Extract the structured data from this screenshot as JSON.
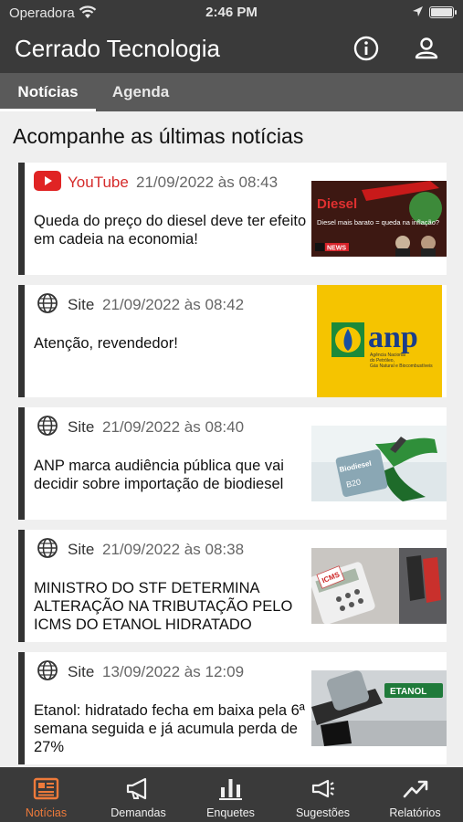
{
  "status_bar": {
    "carrier": "Operadora",
    "time": "2:46 PM"
  },
  "app_bar": {
    "title": "Cerrado Tecnologia"
  },
  "tabs": [
    {
      "label": "Notícias",
      "active": true
    },
    {
      "label": "Agenda",
      "active": false
    }
  ],
  "news": {
    "section_title": "Acompanhe as últimas notícias",
    "items": [
      {
        "source": "YouTube",
        "source_icon": "youtube-icon",
        "date": "21/09/2022 às 08:43",
        "headline": "Queda do preço do diesel deve ter efeito em cadeia na economia!",
        "thumb_text": {
          "title": "Diesel",
          "subtitle": "Diesel mais barato = queda na inflação?",
          "badge": "NEWS"
        }
      },
      {
        "source": "Site",
        "source_icon": "globe-icon",
        "date": "21/09/2022 às 08:42",
        "headline": "Atenção, revendedor!",
        "thumb_text": {
          "logo": "anp",
          "tagline_1": "Agência Nacional",
          "tagline_2": "do Petróleo,",
          "tagline_3": "Gás Natural e Biocombustíveis"
        }
      },
      {
        "source": "Site",
        "source_icon": "globe-icon",
        "date": "21/09/2022 às 08:40",
        "headline": "ANP marca audiência pública que vai decidir sobre importação de biodiesel",
        "thumb_text": {
          "label_1": "Biodiesel",
          "label_2": "B20"
        }
      },
      {
        "source": "Site",
        "source_icon": "globe-icon",
        "date": "21/09/2022 às 08:38",
        "headline": "MINISTRO DO STF DETERMINA ALTERAÇÃO NA TRIBUTAÇÃO PELO ICMS DO ETANOL HIDRATADO",
        "thumb_text": {
          "label": "ICMS"
        }
      },
      {
        "source": "Site",
        "source_icon": "globe-icon",
        "date": "13/09/2022 às 12:09",
        "headline": "Etanol: hidratado fecha em baixa pela 6ª semana seguida e já acumula perda de 27%",
        "thumb_text": {
          "label": "ETANOL"
        }
      }
    ]
  },
  "bottom_nav": [
    {
      "label": "Notícias",
      "icon": "newspaper-icon",
      "active": true
    },
    {
      "label": "Demandas",
      "icon": "megaphone-icon",
      "active": false
    },
    {
      "label": "Enquetes",
      "icon": "bar-chart-icon",
      "active": false
    },
    {
      "label": "Sugestões",
      "icon": "bullhorn-icon",
      "active": false
    },
    {
      "label": "Relatórios",
      "icon": "trending-up-icon",
      "active": false
    }
  ],
  "colors": {
    "bar": "#3a3a3a",
    "tabs": "#5a5a5a",
    "accent": "#ee7a3a",
    "youtube": "#d52b2b"
  }
}
